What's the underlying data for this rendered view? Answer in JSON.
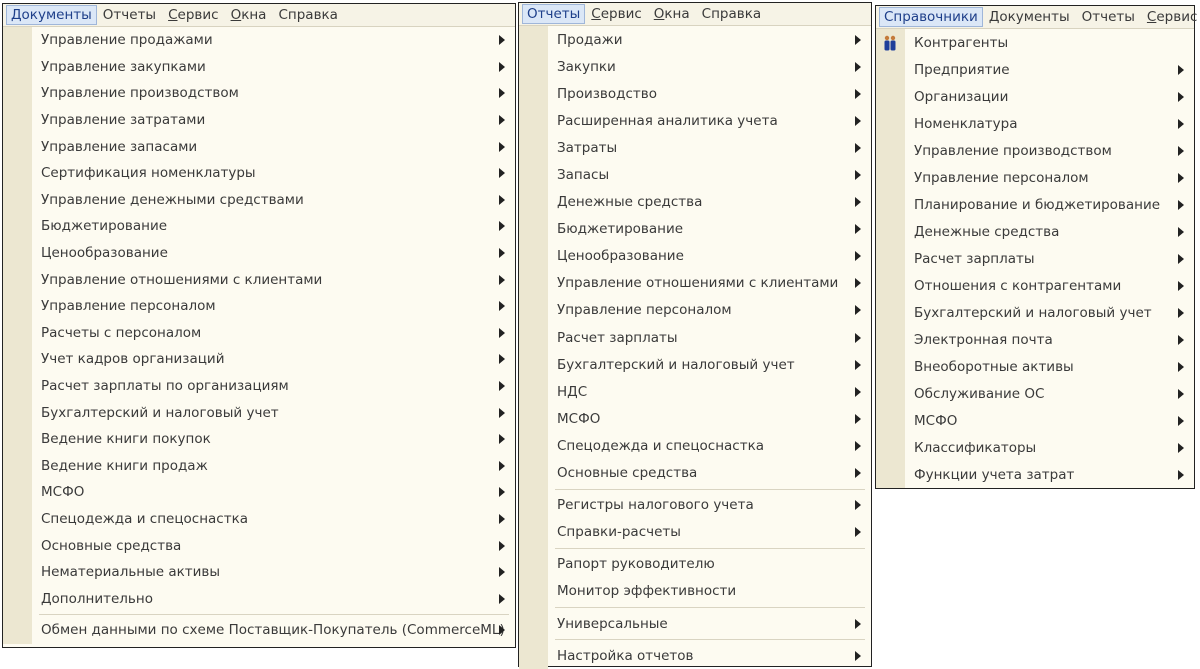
{
  "panels": [
    {
      "menubar": [
        {
          "label": "Документы",
          "active": true
        },
        {
          "label": "Отчеты"
        },
        {
          "label": "Сервис",
          "ul": 0
        },
        {
          "label": "Окна",
          "ul": 0
        },
        {
          "label": "Справка",
          "ul": 3
        }
      ],
      "items": [
        {
          "label": "Управление продажами",
          "arrow": true
        },
        {
          "label": "Управление закупками",
          "arrow": true
        },
        {
          "label": "Управление производством",
          "arrow": true
        },
        {
          "label": "Управление затратами",
          "arrow": true
        },
        {
          "label": "Управление запасами",
          "arrow": true
        },
        {
          "label": "Сертификация номенклатуры",
          "arrow": true
        },
        {
          "label": "Управление денежными средствами",
          "arrow": true
        },
        {
          "label": "Бюджетирование",
          "arrow": true
        },
        {
          "label": "Ценообразование",
          "arrow": true
        },
        {
          "label": "Управление отношениями с клиентами",
          "arrow": true
        },
        {
          "label": "Управление персоналом",
          "arrow": true
        },
        {
          "label": "Расчеты с персоналом",
          "arrow": true
        },
        {
          "label": "Учет кадров организаций",
          "arrow": true
        },
        {
          "label": "Расчет зарплаты по организациям",
          "arrow": true
        },
        {
          "label": "Бухгалтерский и налоговый учет",
          "arrow": true
        },
        {
          "label": "Ведение книги покупок",
          "arrow": true
        },
        {
          "label": "Ведение книги продаж",
          "arrow": true
        },
        {
          "label": "МСФО",
          "arrow": true
        },
        {
          "label": "Спецодежда и спецоснастка",
          "arrow": true
        },
        {
          "label": "Основные средства",
          "arrow": true
        },
        {
          "label": "Нематериальные активы",
          "arrow": true
        },
        {
          "label": "Дополнительно",
          "arrow": true
        },
        {
          "separator": true
        },
        {
          "label": "Обмен данными по схеме Поставщик-Покупатель (CommerceML)",
          "arrow": true
        }
      ]
    },
    {
      "menubar": [
        {
          "label": "Отчеты",
          "active": true
        },
        {
          "label": "Сервис",
          "ul": 0
        },
        {
          "label": "Окна",
          "ul": 0
        },
        {
          "label": "Справка",
          "ul": 3
        }
      ],
      "items": [
        {
          "label": "Продажи",
          "arrow": true
        },
        {
          "label": "Закупки",
          "arrow": true
        },
        {
          "label": "Производство",
          "arrow": true
        },
        {
          "label": "Расширенная аналитика учета",
          "arrow": true
        },
        {
          "label": "Затраты",
          "arrow": true
        },
        {
          "label": "Запасы",
          "arrow": true
        },
        {
          "label": "Денежные средства",
          "arrow": true
        },
        {
          "label": "Бюджетирование",
          "arrow": true
        },
        {
          "label": "Ценообразование",
          "arrow": true
        },
        {
          "label": "Управление отношениями с клиентами",
          "arrow": true
        },
        {
          "label": "Управление персоналом",
          "arrow": true
        },
        {
          "label": "Расчет зарплаты",
          "arrow": true
        },
        {
          "label": "Бухгалтерский и налоговый учет",
          "arrow": true
        },
        {
          "label": "НДС",
          "arrow": true
        },
        {
          "label": "МСФО",
          "arrow": true
        },
        {
          "label": "Спецодежда и спецоснастка",
          "arrow": true
        },
        {
          "label": "Основные средства",
          "arrow": true
        },
        {
          "separator": true
        },
        {
          "label": "Регистры налогового учета",
          "arrow": true
        },
        {
          "label": "Справки-расчеты",
          "arrow": true
        },
        {
          "separator": true
        },
        {
          "label": "Рапорт руководителю",
          "arrow": false
        },
        {
          "label": "Монитор эффективности",
          "arrow": false
        },
        {
          "separator": true
        },
        {
          "label": "Универсальные",
          "arrow": true
        },
        {
          "separator": true
        },
        {
          "label": "Настройка отчетов",
          "arrow": true
        }
      ]
    },
    {
      "menubar": [
        {
          "label": "Справочники",
          "active": true
        },
        {
          "label": "Документы"
        },
        {
          "label": "Отчеты"
        },
        {
          "label": "Сервис",
          "ul": 0
        }
      ],
      "items": [
        {
          "label": "Контрагенты",
          "arrow": false,
          "icon": "people-icon"
        },
        {
          "label": "Предприятие",
          "arrow": true
        },
        {
          "label": "Организации",
          "arrow": true
        },
        {
          "label": "Номенклатура",
          "arrow": true
        },
        {
          "label": "Управление производством",
          "arrow": true
        },
        {
          "label": "Управление персоналом",
          "arrow": true
        },
        {
          "label": "Планирование и бюджетирование",
          "arrow": true
        },
        {
          "label": "Денежные средства",
          "arrow": true
        },
        {
          "label": "Расчет зарплаты",
          "arrow": true
        },
        {
          "label": "Отношения с контрагентами",
          "arrow": true
        },
        {
          "label": "Бухгалтерский и налоговый учет",
          "arrow": true
        },
        {
          "label": "Электронная почта",
          "arrow": true
        },
        {
          "label": "Внеоборотные активы",
          "arrow": true
        },
        {
          "label": "Обслуживание ОС",
          "arrow": true
        },
        {
          "label": "МСФО",
          "arrow": true
        },
        {
          "label": "Классификаторы",
          "arrow": true
        },
        {
          "label": "Функции учета затрат",
          "arrow": true
        }
      ]
    }
  ]
}
